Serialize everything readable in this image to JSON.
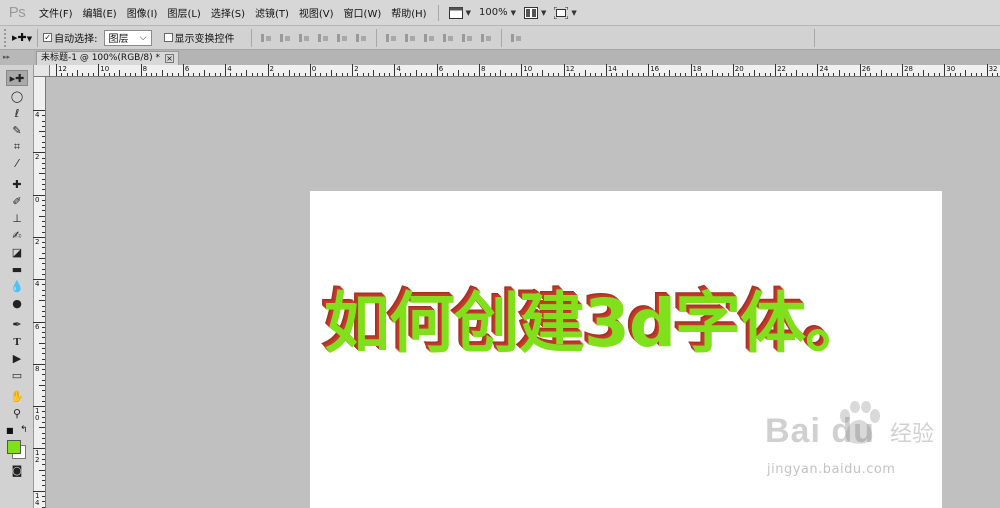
{
  "app": {
    "logo": "Ps"
  },
  "menubar": {
    "items": [
      "文件(F)",
      "编辑(E)",
      "图像(I)",
      "图层(L)",
      "选择(S)",
      "滤镜(T)",
      "视图(V)",
      "窗口(W)",
      "帮助(H)"
    ],
    "zoom": "100%"
  },
  "options": {
    "auto_select_label": "自动选择:",
    "auto_select_value": "图层",
    "show_transform_label": "显示变换控件"
  },
  "document": {
    "tab_title": "未标题-1 @ 100%(RGB/8) *",
    "tab_close": "×",
    "headline": "如何创建3d字体。"
  },
  "ruler": {
    "h_labels": [
      "12",
      "10",
      "8",
      "6",
      "4",
      "2",
      "0",
      "2",
      "4",
      "6",
      "8",
      "10",
      "12",
      "14",
      "16",
      "18",
      "20",
      "22",
      "24",
      "26",
      "28",
      "30",
      "32"
    ],
    "v_labels": [
      "4",
      "2",
      "0",
      "2",
      "4",
      "6",
      "8",
      "10",
      "12",
      "14"
    ]
  },
  "colors": {
    "text_face": "#7fe01b",
    "text_extrude": "#c43a2a",
    "foreground_swatch": "#7fe01b",
    "background_swatch": "#ffffff"
  },
  "watermark": {
    "logo": "Bai du",
    "cn": "经验",
    "url": "jingyan.baidu.com"
  }
}
